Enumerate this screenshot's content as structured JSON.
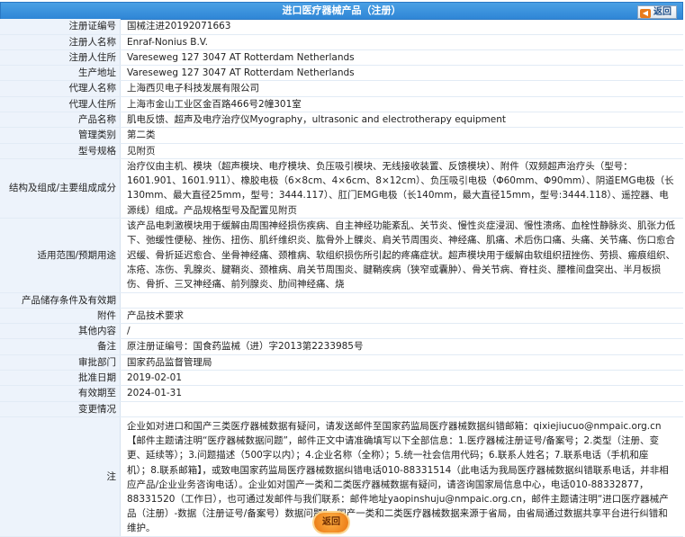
{
  "header": {
    "title": "进口医疗器械产品（注册）",
    "back_label": "返回"
  },
  "rows": {
    "reg_no": {
      "label": "注册证编号",
      "value": "国械注进20192071663"
    },
    "registrant": {
      "label": "注册人名称",
      "value": "Enraf-Nonius B.V."
    },
    "registrant_addr": {
      "label": "注册人住所",
      "value": "Vareseweg 127 3047 AT Rotterdam Netherlands"
    },
    "prod_addr": {
      "label": "生产地址",
      "value": "Vareseweg 127 3047 AT Rotterdam Netherlands"
    },
    "agent": {
      "label": "代理人名称",
      "value": "上海西贝电子科技发展有限公司"
    },
    "agent_addr": {
      "label": "代理人住所",
      "value": "上海市金山工业区金百路466号2幢301室"
    },
    "product_name": {
      "label": "产品名称",
      "value": "肌电反馈、超声及电疗治疗仪Myography，ultrasonic and electrotherapy equipment"
    },
    "mgmt_class": {
      "label": "管理类别",
      "value": "第二类"
    },
    "model": {
      "label": "型号规格",
      "value": "见附页"
    },
    "structure": {
      "label": "结构及组成/主要组成成分",
      "value": "治疗仪由主机、模块（超声模块、电疗模块、负压吸引模块、无线接收装置、反馈模块）、附件（双频超声治疗头（型号：1601.901、1601.911）、橡胶电极（6×8cm、4×6cm、8×12cm）、负压吸引电极（Φ60mm、Φ90mm）、阴道EMG电极（长130mm、最大直径25mm，型号：3444.117）、肛门EMG电极（长140mm，最大直径15mm，型号:3444.118）、遥控器、电源线）组成。产品规格型号及配置见附页"
    },
    "scope": {
      "label": "适用范围/预期用途",
      "value": "该产品电刺激模块用于缓解由周围神经损伤疾病、自主神经功能紊乱、关节炎、慢性炎症浸润、慢性溃疡、血栓性静脉炎、肌张力低下、弛缓性便秘、挫伤、扭伤、肌纤维织炎、肱骨外上髁炎、肩关节周围炎、神经痛、肌痛、术后伤口痛、头痛、关节痛、伤口愈合迟缓、骨折延迟愈合、坐骨神经痛、颈椎病、软组织损伤所引起的疼痛症状。超声模块用于缓解由软组织扭挫伤、劳损、瘢痕组织、冻疮、冻伤、乳腺炎、腱鞘炎、颈椎病、肩关节周围炎、腱鞘疾病（狭窄或囊肿）、骨关节病、脊柱炎、腰椎间盘突出、半月板损伤、骨折、三叉神经痛、前列腺炎、肋间神经痛、烧"
    },
    "storage": {
      "label": "产品储存条件及有效期",
      "value": ""
    },
    "attachment": {
      "label": "附件",
      "value": "产品技术要求"
    },
    "other": {
      "label": "其他内容",
      "value": "/"
    },
    "remark": {
      "label": "备注",
      "value": "原注册证编号：国食药监械（进）字2013第2233985号"
    },
    "approval_dept": {
      "label": "审批部门",
      "value": "国家药品监督管理局"
    },
    "approval_date": {
      "label": "批准日期",
      "value": "2019-02-01"
    },
    "valid_until": {
      "label": "有效期至",
      "value": "2024-01-31"
    },
    "changes": {
      "label": "变更情况",
      "value": ""
    },
    "note": {
      "label": "注",
      "value": "企业如对进口和国产三类医疗器械数据有疑问，请发送邮件至国家药监局医疗器械数据纠错邮箱：qixiejiucuo@nmpaic.org.cn【邮件主题请注明“医疗器械数据问题”，邮件正文中请准确填写以下全部信息：1.医疗器械注册证号/备案号；2.类型（注册、变更、延续等）；3.问题描述（500字以内）；4.企业名称（全称）；5.统一社会信用代码；6.联系人姓名；7.联系电话（手机和座机）；8.联系邮箱】，或致电国家药监局医疗器械数据纠错电话010-88331514（此电话为我局医疗器械数据纠错联系电话，并非相应产品/企业业务咨询电话）。企业如对国产一类和二类医疗器械数据有疑问，请咨询国家局信息中心，电话010-88332877，88331520（工作日），也可通过发邮件与我们联系：邮件地址yaopinshuju@nmpaic.org.cn，邮件主题请注明“进口医疗器械产品（注册）-数据（注册证号/备案号）数据问题”。国产一类和二类医疗器械数据来源于省局，由省局通过数据共享平台进行纠错和维护。"
    }
  },
  "colors": {
    "header_bg": "#3a92dc",
    "label_bg": "#edf3fb",
    "back_button_accent": "#e8740f"
  }
}
